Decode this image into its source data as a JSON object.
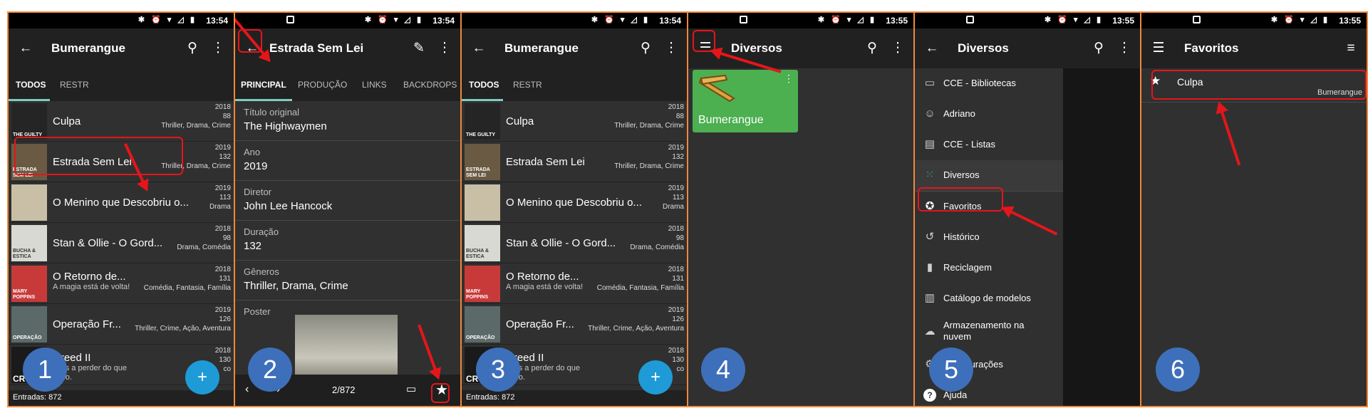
{
  "status": {
    "time1": "13:54",
    "time2": "13:54",
    "time3": "13:54",
    "time4": "13:55",
    "time5": "13:55",
    "time6": "13:55",
    "icons": "✱ ⏰ ▾ ◿ ▮"
  },
  "steps": [
    "1",
    "2",
    "3",
    "4",
    "5",
    "6"
  ],
  "p1": {
    "title": "Bumerangue",
    "tabs": [
      "TODOS",
      "RESTR"
    ],
    "rows": [
      {
        "title": "Culpa",
        "subtitle": "",
        "year": "2018",
        "minutes": "88",
        "genres": "Thriller, Drama, Crime",
        "thumb": "THE GUILTY"
      },
      {
        "title": "Estrada Sem Lei",
        "subtitle": "",
        "year": "2019",
        "minutes": "132",
        "genres": "Thriller, Drama, Crime",
        "thumb": "ESTRADA SEM LEI"
      },
      {
        "title": "O Menino que Descobriu o...",
        "subtitle": "",
        "year": "2019",
        "minutes": "113",
        "genres": "Drama",
        "thumb": ""
      },
      {
        "title": "Stan & Ollie - O Gord...",
        "subtitle": "",
        "year": "2018",
        "minutes": "98",
        "genres": "Drama, Comédia",
        "thumb": "BUCHA & ESTICA"
      },
      {
        "title": "O Retorno de...",
        "subtitle": "A magia está de volta!",
        "year": "2018",
        "minutes": "131",
        "genres": "Comédia, Fantasia, Família",
        "thumb": "MARY POPPINS"
      },
      {
        "title": "Operação Fr...",
        "subtitle": "",
        "year": "2019",
        "minutes": "126",
        "genres": "Thriller, Crime, Ação, Aventura",
        "thumb": "OPERAÇÃO"
      },
      {
        "title": "Creed II",
        "subtitle": "mais a perder do que título.",
        "year": "2018",
        "minutes": "130",
        "genres": "co",
        "thumb": "CR"
      }
    ],
    "footer": "Entradas: 872",
    "fab": "+"
  },
  "p2": {
    "title": "Estrada Sem Lei",
    "tabs": [
      "PRINCIPAL",
      "PRODUÇÃO",
      "LINKS",
      "BACKDROPS"
    ],
    "fields": [
      {
        "label": "Título original",
        "value": "The Highwaymen"
      },
      {
        "label": "Ano",
        "value": "2019"
      },
      {
        "label": "Diretor",
        "value": "John Lee Hancock"
      },
      {
        "label": "Duração",
        "value": "132"
      },
      {
        "label": "Gêneros",
        "value": "Thriller, Drama, Crime"
      }
    ],
    "poster_label": "Poster",
    "pager": "2/872"
  },
  "p3": {
    "title": "Bumerangue",
    "tabs": [
      "TODOS",
      "RESTR"
    ],
    "footer": "Entradas: 872",
    "fab": "+"
  },
  "p4": {
    "title": "Diversos",
    "card_label": "Bumerangue"
  },
  "p5": {
    "title": "Diversos",
    "items": [
      {
        "label": "CCE - Bibliotecas",
        "icon": "book-icon",
        "glyph": "▭"
      },
      {
        "label": "Adriano",
        "icon": "smiley-icon",
        "glyph": "☺"
      },
      {
        "label": "CCE - Listas",
        "icon": "clipboard-icon",
        "glyph": "▤"
      },
      {
        "label": "Diversos",
        "icon": "grid-icon",
        "glyph": "⁙"
      },
      {
        "label": "Favoritos",
        "icon": "star-circle-icon",
        "glyph": "✪"
      },
      {
        "label": "Histórico",
        "icon": "history-icon",
        "glyph": "↺"
      },
      {
        "label": "Reciclagem",
        "icon": "trash-icon",
        "glyph": "▮"
      },
      {
        "label": "Catálogo de modelos",
        "icon": "catalog-icon",
        "glyph": "▥"
      },
      {
        "label": "Armazenamento na nuvem",
        "icon": "cloud-icon",
        "glyph": "☁"
      },
      {
        "label": "Configurações",
        "icon": "gear-icon",
        "glyph": "⚙"
      },
      {
        "label": "Ajuda",
        "icon": "help-icon",
        "glyph": "?"
      }
    ]
  },
  "p6": {
    "title": "Favoritos",
    "fav_title": "Culpa",
    "fav_source": "Bumerangue"
  },
  "colors": {
    "border": "#f0883a",
    "highlight": "#e5161a",
    "badge": "#3e6fba",
    "fab": "#1e9bd7",
    "folder": "#4caf50",
    "tab_indicator": "#80cbc4"
  }
}
